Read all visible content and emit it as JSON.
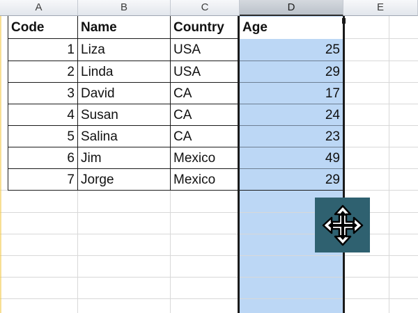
{
  "columns": [
    "A",
    "B",
    "C",
    "D",
    "E"
  ],
  "selected_column": "D",
  "table": {
    "headers": [
      "Code",
      "Name",
      "Country",
      "Age"
    ],
    "rows": [
      [
        "1",
        "Liza",
        "USA",
        "25"
      ],
      [
        "2",
        "Linda",
        "USA",
        "29"
      ],
      [
        "3",
        "David",
        "CA",
        "17"
      ],
      [
        "4",
        "Susan",
        "CA",
        "24"
      ],
      [
        "5",
        "Salina",
        "CA",
        "23"
      ],
      [
        "6",
        "Jim",
        "Mexico",
        "49"
      ],
      [
        "7",
        "Jorge",
        "Mexico",
        "29"
      ]
    ]
  },
  "cursor": {
    "icon": "move-cursor-icon"
  },
  "colors": {
    "selection_fill": "#bcd7f5",
    "cursor_bg": "#2f6170",
    "grid": "#d8d8d8"
  }
}
